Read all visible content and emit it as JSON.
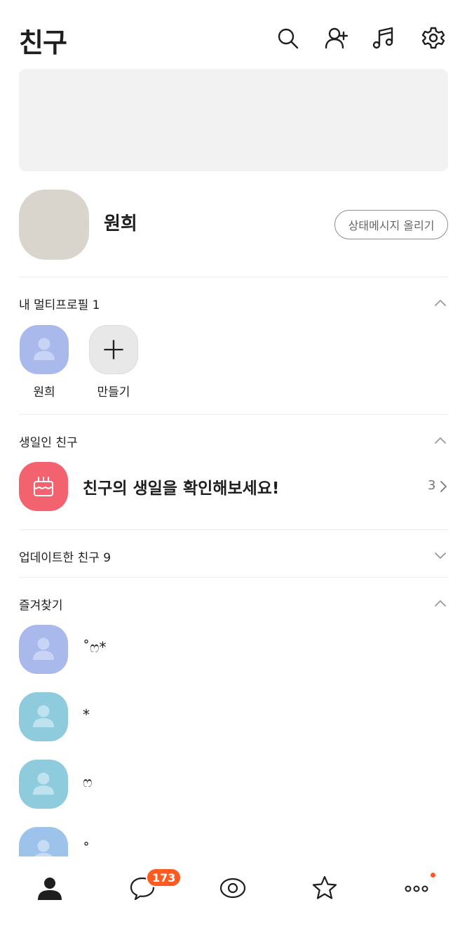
{
  "header": {
    "title": "친구",
    "icons": [
      "search-icon",
      "add-friend-icon",
      "music-icon",
      "settings-icon"
    ]
  },
  "my_profile": {
    "name": "원희",
    "status_button": "상태메시지 올리기"
  },
  "multi_profile": {
    "title": "내 멀티프로필 1",
    "items": [
      {
        "label": "원희",
        "color": "#a9b9ec"
      },
      {
        "label": "만들기",
        "color": "#e8e8e8"
      }
    ]
  },
  "birthday": {
    "title": "생일인 친구",
    "message": "친구의 생일을 확인해보세요!",
    "count": "3",
    "color": "#f2626f"
  },
  "updated": {
    "title": "업데이트한 친구 9"
  },
  "favorites": {
    "title": "즐겨찾기",
    "items": [
      {
        "name": "˚ෆ*",
        "color": "#a9b9ec"
      },
      {
        "name": "*",
        "color": "#8ecbdc"
      },
      {
        "name": "ෆ",
        "color": "#8ecbdc"
      },
      {
        "name": "˚",
        "color": "#9dc3ea"
      }
    ]
  },
  "tabbar": {
    "tabs": [
      "friends-icon",
      "chat-icon",
      "view-icon",
      "shopping-icon",
      "more-icon"
    ],
    "chat_badge": "173",
    "accent": "#ff5a1f"
  }
}
